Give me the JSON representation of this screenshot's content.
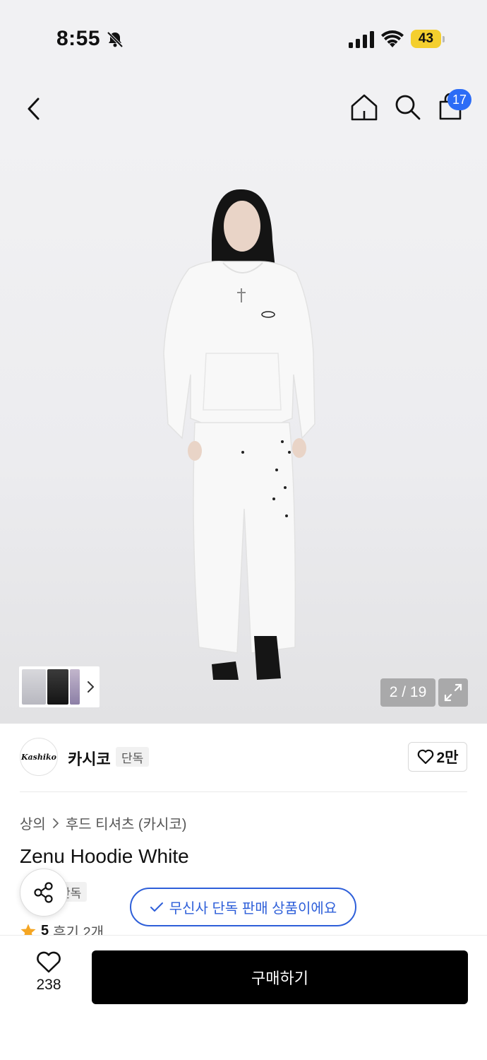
{
  "status_bar": {
    "time": "8:55",
    "battery": "43",
    "icons": [
      "bell-slash-icon",
      "signal-icon",
      "wifi-icon",
      "battery-icon"
    ]
  },
  "nav": {
    "icons": [
      "chevron-left-icon",
      "home-icon",
      "search-icon",
      "shopping-bag-icon"
    ],
    "cart_count": "17"
  },
  "gallery": {
    "page_indicator": "2 / 19",
    "expand_icon": "expand-icon"
  },
  "brand": {
    "logo_text": "Kashiko",
    "name": "카시코",
    "tag": "단독",
    "likes": "2만"
  },
  "product": {
    "breadcrumb": [
      "상의",
      "후드 티셔츠 (카시코)"
    ],
    "title": "Zenu Hoodie White",
    "tag": "단독",
    "exclusive_notice": "무신사 단독 판매 상품이에요",
    "rating": "5",
    "reviews": "후기 2개"
  },
  "bottom": {
    "wishlist_count": "238",
    "buy_label": "구매하기"
  },
  "colors": {
    "accent_blue": "#2e5fd9",
    "badge_blue": "#2c6cf6",
    "buy_button": "#000000",
    "star": "#f5a623",
    "battery": "#f4cf2e"
  }
}
